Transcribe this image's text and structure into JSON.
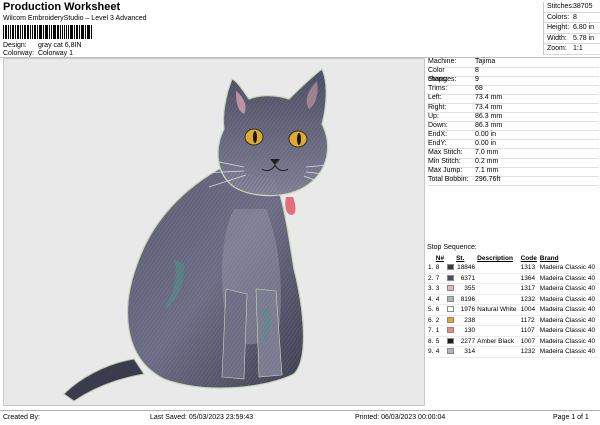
{
  "header": {
    "title": "Production Worksheet",
    "subtitle": "Wilcom EmbroideryStudio – Level 3 Advanced",
    "design_label": "Design:",
    "design_value": "gray cat 6,8IN",
    "colorway_label": "Colorway:",
    "colorway_value": "Colorway 1"
  },
  "stats": [
    {
      "k": "Stitches:",
      "v": "38705"
    },
    {
      "k": "Colors:",
      "v": "8"
    },
    {
      "k": "Height:",
      "v": "6.80 in"
    },
    {
      "k": "Width:",
      "v": "5.78 in"
    },
    {
      "k": "Zoom:",
      "v": "1:1"
    }
  ],
  "machine_info": [
    {
      "k": "Machine:",
      "v": "Tajima"
    },
    {
      "k": "Color changes:",
      "v": "8"
    },
    {
      "k": "Stops:",
      "v": "9"
    },
    {
      "k": "Trims:",
      "v": "68"
    },
    {
      "k": "Left:",
      "v": "73.4 mm"
    },
    {
      "k": "Right:",
      "v": "73.4 mm"
    },
    {
      "k": "Up:",
      "v": "86.3 mm"
    },
    {
      "k": "Down:",
      "v": "86.3 mm"
    },
    {
      "k": "EndX:",
      "v": "0.00 in"
    },
    {
      "k": "EndY:",
      "v": "0.00 in"
    },
    {
      "k": "Max Stitch:",
      "v": "7.0 mm"
    },
    {
      "k": "Min Stitch:",
      "v": "0.2 mm"
    },
    {
      "k": "Max Jump:",
      "v": "7.1 mm"
    },
    {
      "k": "Total Bobbin:",
      "v": "296.76ft"
    }
  ],
  "stop_sequence": {
    "label": "Stop Sequence:",
    "headers": {
      "num": "N#",
      "st": "St.",
      "desc": "Description",
      "code": "Code",
      "brand": "Brand"
    },
    "rows": [
      {
        "stop": "1.",
        "n": "8",
        "color": "#3b3c4a",
        "st": "18846",
        "desc": "",
        "code": "1313",
        "brand": "Madeira Classic 40"
      },
      {
        "stop": "2.",
        "n": "7",
        "color": "#4a4b5e",
        "st": "6371",
        "desc": "",
        "code": "1364",
        "brand": "Madeira Classic 40"
      },
      {
        "stop": "3.",
        "n": "3",
        "color": "#e9b4c0",
        "st": "355",
        "desc": "",
        "code": "1317",
        "brand": "Madeira Classic 40"
      },
      {
        "stop": "4.",
        "n": "4",
        "color": "#b3b3c6",
        "st": "8196",
        "desc": "",
        "code": "1232",
        "brand": "Madeira Classic 40"
      },
      {
        "stop": "5.",
        "n": "6",
        "color": "#ffffff",
        "st": "1976",
        "desc": "Natural White",
        "code": "1004",
        "brand": "Madeira Classic 40"
      },
      {
        "stop": "6.",
        "n": "2",
        "color": "#f0a12a",
        "st": "238",
        "desc": "",
        "code": "1172",
        "brand": "Madeira Classic 40"
      },
      {
        "stop": "7.",
        "n": "1",
        "color": "#ef8a83",
        "st": "130",
        "desc": "",
        "code": "1107",
        "brand": "Madeira Classic 40"
      },
      {
        "stop": "8.",
        "n": "5",
        "color": "#1a1a1a",
        "st": "2277",
        "desc": "Amber Black",
        "code": "1007",
        "brand": "Madeira Classic 40"
      },
      {
        "stop": "9.",
        "n": "4",
        "color": "#b3b3c6",
        "st": "314",
        "desc": "",
        "code": "1232",
        "brand": "Madeira Classic 40"
      }
    ]
  },
  "footer": {
    "created_by": "Created By:",
    "last_saved": "Last Saved: 05/03/2023 23:59:43",
    "printed": "Printed: 06/03/2023 00:00:04",
    "page": "Page 1 of 1"
  },
  "image": {
    "subject": "gray-cat-embroidery"
  }
}
